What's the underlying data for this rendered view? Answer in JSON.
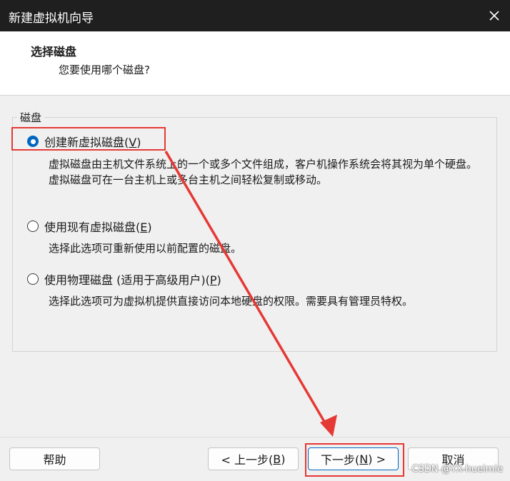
{
  "window": {
    "title": "新建虚拟机向导"
  },
  "header": {
    "title": "选择磁盘",
    "subtitle": "您要使用哪个磁盘?"
  },
  "group": {
    "label": "磁盘"
  },
  "options": [
    {
      "label_main": "创建新虚拟磁盘(",
      "mnemonic": "V",
      "label_end": ")",
      "checked": true,
      "description": "虚拟磁盘由主机文件系统上的一个或多个文件组成，客户机操作系统会将其视为单个硬盘。虚拟磁盘可在一台主机上或多台主机之间轻松复制或移动。"
    },
    {
      "label_main": "使用现有虚拟磁盘(",
      "mnemonic": "E",
      "label_end": ")",
      "checked": false,
      "description": "选择此选项可重新使用以前配置的磁盘。"
    },
    {
      "label_main": "使用物理磁盘 (适用于高级用户)(",
      "mnemonic": "P",
      "label_end": ")",
      "checked": false,
      "description": "选择此选项可为虚拟机提供直接访问本地硬盘的权限。需要具有管理员特权。"
    }
  ],
  "buttons": {
    "help": "帮助",
    "back": {
      "pre": "< 上一步(",
      "mnemonic": "B",
      "post": ")"
    },
    "next": {
      "pre": "下一步(",
      "mnemonic": "N",
      "post": ") >"
    },
    "cancel": "取消"
  },
  "watermark": "CSDN @YX-hueimie",
  "colors": {
    "accent": "#0067c0",
    "annotation": "#e53935",
    "titlebar": "#1f1f1f"
  }
}
